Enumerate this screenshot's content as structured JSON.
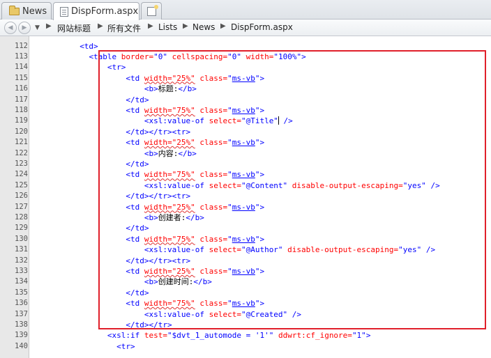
{
  "tabs": [
    {
      "label": "News"
    },
    {
      "label": "DispForm.aspx"
    }
  ],
  "breadcrumb": [
    "网站标题",
    "所有文件",
    "Lists",
    "News",
    "DispForm.aspx"
  ],
  "colors": {
    "highlight_box": "#e01f2a",
    "tag": "#0000ff",
    "attribute": "#ff0000"
  },
  "code_lines": [
    {
      "n": "112",
      "indent": 10,
      "tokens": [
        {
          "t": "<td>",
          "c": "t"
        }
      ]
    },
    {
      "n": "113",
      "indent": 12,
      "tokens": [
        {
          "t": "<table",
          "c": "t"
        },
        {
          "t": " border=",
          "c": "a"
        },
        {
          "t": "\"0\"",
          "c": "v"
        },
        {
          "t": " cellspacing=",
          "c": "a"
        },
        {
          "t": "\"0\"",
          "c": "v"
        },
        {
          "t": " width=",
          "c": "a"
        },
        {
          "t": "\"100%\"",
          "c": "v"
        },
        {
          "t": ">",
          "c": "t"
        }
      ]
    },
    {
      "n": "114",
      "indent": 16,
      "tokens": [
        {
          "t": "<tr>",
          "c": "t"
        }
      ]
    },
    {
      "n": "115",
      "indent": 20,
      "tokens": [
        {
          "t": "<td",
          "c": "t"
        },
        {
          "t": " ",
          "c": ""
        },
        {
          "t": "width=\"25%\"",
          "c": "a sq"
        },
        {
          "t": " class=",
          "c": "a"
        },
        {
          "t": "\"",
          "c": "v"
        },
        {
          "t": "ms-vb",
          "c": "v u"
        },
        {
          "t": "\">",
          "c": "v"
        }
      ]
    },
    {
      "n": "116",
      "indent": 24,
      "tokens": [
        {
          "t": "<b>",
          "c": "t"
        },
        {
          "t": "标题:",
          "c": "txt"
        },
        {
          "t": "</b>",
          "c": "t"
        }
      ]
    },
    {
      "n": "117",
      "indent": 20,
      "tokens": [
        {
          "t": "</td>",
          "c": "t"
        }
      ]
    },
    {
      "n": "118",
      "indent": 20,
      "tokens": [
        {
          "t": "<td",
          "c": "t"
        },
        {
          "t": " ",
          "c": ""
        },
        {
          "t": "width=\"75%\"",
          "c": "a sq"
        },
        {
          "t": " class=",
          "c": "a"
        },
        {
          "t": "\"",
          "c": "v"
        },
        {
          "t": "ms-vb",
          "c": "v u"
        },
        {
          "t": "\">",
          "c": "v"
        }
      ]
    },
    {
      "n": "119",
      "indent": 24,
      "tokens": [
        {
          "t": "<xsl:value-of",
          "c": "t"
        },
        {
          "t": " select=",
          "c": "a"
        },
        {
          "t": "\"@Title\"",
          "c": "v"
        },
        {
          "t": "|",
          "c": "caret"
        },
        {
          "t": " />",
          "c": "t"
        }
      ]
    },
    {
      "n": "120",
      "indent": 20,
      "tokens": [
        {
          "t": "</td></tr><tr>",
          "c": "t"
        }
      ]
    },
    {
      "n": "121",
      "indent": 20,
      "tokens": [
        {
          "t": "<td",
          "c": "t"
        },
        {
          "t": " ",
          "c": ""
        },
        {
          "t": "width=\"25%\"",
          "c": "a sq"
        },
        {
          "t": " class=",
          "c": "a"
        },
        {
          "t": "\"",
          "c": "v"
        },
        {
          "t": "ms-vb",
          "c": "v u"
        },
        {
          "t": "\">",
          "c": "v"
        }
      ]
    },
    {
      "n": "122",
      "indent": 24,
      "tokens": [
        {
          "t": "<b>",
          "c": "t"
        },
        {
          "t": "内容:",
          "c": "txt"
        },
        {
          "t": "</b>",
          "c": "t"
        }
      ]
    },
    {
      "n": "123",
      "indent": 20,
      "tokens": [
        {
          "t": "</td>",
          "c": "t"
        }
      ]
    },
    {
      "n": "124",
      "indent": 20,
      "tokens": [
        {
          "t": "<td",
          "c": "t"
        },
        {
          "t": " ",
          "c": ""
        },
        {
          "t": "width=\"75%\"",
          "c": "a sq"
        },
        {
          "t": " class=",
          "c": "a"
        },
        {
          "t": "\"",
          "c": "v"
        },
        {
          "t": "ms-vb",
          "c": "v u"
        },
        {
          "t": "\">",
          "c": "v"
        }
      ]
    },
    {
      "n": "125",
      "indent": 24,
      "tokens": [
        {
          "t": "<xsl:value-of",
          "c": "t"
        },
        {
          "t": " select=",
          "c": "a"
        },
        {
          "t": "\"@Content\"",
          "c": "v"
        },
        {
          "t": " disable-output-escaping=",
          "c": "a"
        },
        {
          "t": "\"yes\"",
          "c": "v"
        },
        {
          "t": " />",
          "c": "t"
        }
      ]
    },
    {
      "n": "126",
      "indent": 20,
      "tokens": [
        {
          "t": "</td></tr><tr>",
          "c": "t"
        }
      ]
    },
    {
      "n": "127",
      "indent": 20,
      "tokens": [
        {
          "t": "<td",
          "c": "t"
        },
        {
          "t": " ",
          "c": ""
        },
        {
          "t": "width=\"25%\"",
          "c": "a sq"
        },
        {
          "t": " class=",
          "c": "a"
        },
        {
          "t": "\"",
          "c": "v"
        },
        {
          "t": "ms-vb",
          "c": "v u"
        },
        {
          "t": "\">",
          "c": "v"
        }
      ]
    },
    {
      "n": "128",
      "indent": 24,
      "tokens": [
        {
          "t": "<b>",
          "c": "t"
        },
        {
          "t": "创建者:",
          "c": "txt"
        },
        {
          "t": "</b>",
          "c": "t"
        }
      ]
    },
    {
      "n": "129",
      "indent": 20,
      "tokens": [
        {
          "t": "</td>",
          "c": "t"
        }
      ]
    },
    {
      "n": "130",
      "indent": 20,
      "tokens": [
        {
          "t": "<td",
          "c": "t"
        },
        {
          "t": " ",
          "c": ""
        },
        {
          "t": "width=\"75%\"",
          "c": "a sq"
        },
        {
          "t": " class=",
          "c": "a"
        },
        {
          "t": "\"",
          "c": "v"
        },
        {
          "t": "ms-vb",
          "c": "v u"
        },
        {
          "t": "\">",
          "c": "v"
        }
      ]
    },
    {
      "n": "131",
      "indent": 24,
      "tokens": [
        {
          "t": "<xsl:value-of",
          "c": "t"
        },
        {
          "t": " select=",
          "c": "a"
        },
        {
          "t": "\"@Author\"",
          "c": "v"
        },
        {
          "t": " disable-output-escaping=",
          "c": "a"
        },
        {
          "t": "\"yes\"",
          "c": "v"
        },
        {
          "t": " />",
          "c": "t"
        }
      ]
    },
    {
      "n": "132",
      "indent": 20,
      "tokens": [
        {
          "t": "</td></tr><tr>",
          "c": "t"
        }
      ]
    },
    {
      "n": "133",
      "indent": 20,
      "tokens": [
        {
          "t": "<td",
          "c": "t"
        },
        {
          "t": " ",
          "c": ""
        },
        {
          "t": "width=\"25%\"",
          "c": "a sq"
        },
        {
          "t": " class=",
          "c": "a"
        },
        {
          "t": "\"",
          "c": "v"
        },
        {
          "t": "ms-vb",
          "c": "v u"
        },
        {
          "t": "\">",
          "c": "v"
        }
      ]
    },
    {
      "n": "134",
      "indent": 24,
      "tokens": [
        {
          "t": "<b>",
          "c": "t"
        },
        {
          "t": "创建时间:",
          "c": "txt"
        },
        {
          "t": "</b>",
          "c": "t"
        }
      ]
    },
    {
      "n": "135",
      "indent": 20,
      "tokens": [
        {
          "t": "</td>",
          "c": "t"
        }
      ]
    },
    {
      "n": "136",
      "indent": 20,
      "tokens": [
        {
          "t": "<td",
          "c": "t"
        },
        {
          "t": " ",
          "c": ""
        },
        {
          "t": "width=\"75%\"",
          "c": "a sq"
        },
        {
          "t": " class=",
          "c": "a"
        },
        {
          "t": "\"",
          "c": "v"
        },
        {
          "t": "ms-vb",
          "c": "v u"
        },
        {
          "t": "\">",
          "c": "v"
        }
      ]
    },
    {
      "n": "137",
      "indent": 24,
      "tokens": [
        {
          "t": "<xsl:value-of",
          "c": "t"
        },
        {
          "t": " select=",
          "c": "a"
        },
        {
          "t": "\"@Created\"",
          "c": "v"
        },
        {
          "t": " />",
          "c": "t"
        }
      ]
    },
    {
      "n": "138",
      "indent": 20,
      "tokens": [
        {
          "t": "</td></tr>",
          "c": "t"
        }
      ]
    },
    {
      "n": "139",
      "indent": 16,
      "tokens": [
        {
          "t": "<xsl:if",
          "c": "t"
        },
        {
          "t": " test=",
          "c": "a"
        },
        {
          "t": "\"$dvt_1_automode = '1'\"",
          "c": "v"
        },
        {
          "t": " ddwrt:cf_ignore=",
          "c": "a"
        },
        {
          "t": "\"1\"",
          "c": "v"
        },
        {
          "t": ">",
          "c": "t"
        }
      ]
    },
    {
      "n": "140",
      "indent": 18,
      "tokens": [
        {
          "t": "<tr>",
          "c": "t"
        }
      ]
    }
  ]
}
